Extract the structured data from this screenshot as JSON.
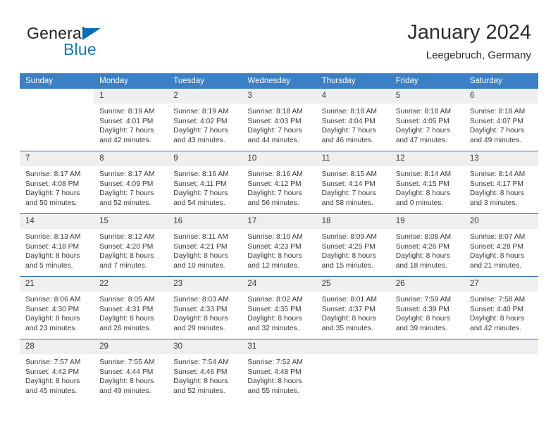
{
  "brand": {
    "line1": "General",
    "line2": "Blue",
    "triangle_color": "#0b6cb7",
    "blue_color": "#1278be"
  },
  "header": {
    "title": "January 2024",
    "subtitle": "Leegebruch, Germany"
  },
  "theme": {
    "header_row_bg": "#3b7fc4",
    "row_divider": "#2f6fb0",
    "daynum_bg": "#efefef",
    "text": "#3a3a3a"
  },
  "calendar": {
    "weekday_headers": [
      "Sunday",
      "Monday",
      "Tuesday",
      "Wednesday",
      "Thursday",
      "Friday",
      "Saturday"
    ],
    "weeks": [
      [
        {
          "day": "",
          "lines": []
        },
        {
          "day": "1",
          "lines": [
            "Sunrise: 8:19 AM",
            "Sunset: 4:01 PM",
            "Daylight: 7 hours",
            "and 42 minutes."
          ]
        },
        {
          "day": "2",
          "lines": [
            "Sunrise: 8:19 AM",
            "Sunset: 4:02 PM",
            "Daylight: 7 hours",
            "and 43 minutes."
          ]
        },
        {
          "day": "3",
          "lines": [
            "Sunrise: 8:18 AM",
            "Sunset: 4:03 PM",
            "Daylight: 7 hours",
            "and 44 minutes."
          ]
        },
        {
          "day": "4",
          "lines": [
            "Sunrise: 8:18 AM",
            "Sunset: 4:04 PM",
            "Daylight: 7 hours",
            "and 46 minutes."
          ]
        },
        {
          "day": "5",
          "lines": [
            "Sunrise: 8:18 AM",
            "Sunset: 4:05 PM",
            "Daylight: 7 hours",
            "and 47 minutes."
          ]
        },
        {
          "day": "6",
          "lines": [
            "Sunrise: 8:18 AM",
            "Sunset: 4:07 PM",
            "Daylight: 7 hours",
            "and 49 minutes."
          ]
        }
      ],
      [
        {
          "day": "7",
          "lines": [
            "Sunrise: 8:17 AM",
            "Sunset: 4:08 PM",
            "Daylight: 7 hours",
            "and 50 minutes."
          ]
        },
        {
          "day": "8",
          "lines": [
            "Sunrise: 8:17 AM",
            "Sunset: 4:09 PM",
            "Daylight: 7 hours",
            "and 52 minutes."
          ]
        },
        {
          "day": "9",
          "lines": [
            "Sunrise: 8:16 AM",
            "Sunset: 4:11 PM",
            "Daylight: 7 hours",
            "and 54 minutes."
          ]
        },
        {
          "day": "10",
          "lines": [
            "Sunrise: 8:16 AM",
            "Sunset: 4:12 PM",
            "Daylight: 7 hours",
            "and 56 minutes."
          ]
        },
        {
          "day": "11",
          "lines": [
            "Sunrise: 8:15 AM",
            "Sunset: 4:14 PM",
            "Daylight: 7 hours",
            "and 58 minutes."
          ]
        },
        {
          "day": "12",
          "lines": [
            "Sunrise: 8:14 AM",
            "Sunset: 4:15 PM",
            "Daylight: 8 hours",
            "and 0 minutes."
          ]
        },
        {
          "day": "13",
          "lines": [
            "Sunrise: 8:14 AM",
            "Sunset: 4:17 PM",
            "Daylight: 8 hours",
            "and 3 minutes."
          ]
        }
      ],
      [
        {
          "day": "14",
          "lines": [
            "Sunrise: 8:13 AM",
            "Sunset: 4:18 PM",
            "Daylight: 8 hours",
            "and 5 minutes."
          ]
        },
        {
          "day": "15",
          "lines": [
            "Sunrise: 8:12 AM",
            "Sunset: 4:20 PM",
            "Daylight: 8 hours",
            "and 7 minutes."
          ]
        },
        {
          "day": "16",
          "lines": [
            "Sunrise: 8:11 AM",
            "Sunset: 4:21 PM",
            "Daylight: 8 hours",
            "and 10 minutes."
          ]
        },
        {
          "day": "17",
          "lines": [
            "Sunrise: 8:10 AM",
            "Sunset: 4:23 PM",
            "Daylight: 8 hours",
            "and 12 minutes."
          ]
        },
        {
          "day": "18",
          "lines": [
            "Sunrise: 8:09 AM",
            "Sunset: 4:25 PM",
            "Daylight: 8 hours",
            "and 15 minutes."
          ]
        },
        {
          "day": "19",
          "lines": [
            "Sunrise: 8:08 AM",
            "Sunset: 4:26 PM",
            "Daylight: 8 hours",
            "and 18 minutes."
          ]
        },
        {
          "day": "20",
          "lines": [
            "Sunrise: 8:07 AM",
            "Sunset: 4:28 PM",
            "Daylight: 8 hours",
            "and 21 minutes."
          ]
        }
      ],
      [
        {
          "day": "21",
          "lines": [
            "Sunrise: 8:06 AM",
            "Sunset: 4:30 PM",
            "Daylight: 8 hours",
            "and 23 minutes."
          ]
        },
        {
          "day": "22",
          "lines": [
            "Sunrise: 8:05 AM",
            "Sunset: 4:31 PM",
            "Daylight: 8 hours",
            "and 26 minutes."
          ]
        },
        {
          "day": "23",
          "lines": [
            "Sunrise: 8:03 AM",
            "Sunset: 4:33 PM",
            "Daylight: 8 hours",
            "and 29 minutes."
          ]
        },
        {
          "day": "24",
          "lines": [
            "Sunrise: 8:02 AM",
            "Sunset: 4:35 PM",
            "Daylight: 8 hours",
            "and 32 minutes."
          ]
        },
        {
          "day": "25",
          "lines": [
            "Sunrise: 8:01 AM",
            "Sunset: 4:37 PM",
            "Daylight: 8 hours",
            "and 35 minutes."
          ]
        },
        {
          "day": "26",
          "lines": [
            "Sunrise: 7:59 AM",
            "Sunset: 4:39 PM",
            "Daylight: 8 hours",
            "and 39 minutes."
          ]
        },
        {
          "day": "27",
          "lines": [
            "Sunrise: 7:58 AM",
            "Sunset: 4:40 PM",
            "Daylight: 8 hours",
            "and 42 minutes."
          ]
        }
      ],
      [
        {
          "day": "28",
          "lines": [
            "Sunrise: 7:57 AM",
            "Sunset: 4:42 PM",
            "Daylight: 8 hours",
            "and 45 minutes."
          ]
        },
        {
          "day": "29",
          "lines": [
            "Sunrise: 7:55 AM",
            "Sunset: 4:44 PM",
            "Daylight: 8 hours",
            "and 49 minutes."
          ]
        },
        {
          "day": "30",
          "lines": [
            "Sunrise: 7:54 AM",
            "Sunset: 4:46 PM",
            "Daylight: 8 hours",
            "and 52 minutes."
          ]
        },
        {
          "day": "31",
          "lines": [
            "Sunrise: 7:52 AM",
            "Sunset: 4:48 PM",
            "Daylight: 8 hours",
            "and 55 minutes."
          ]
        },
        {
          "day": "",
          "lines": []
        },
        {
          "day": "",
          "lines": []
        },
        {
          "day": "",
          "lines": []
        }
      ]
    ]
  }
}
